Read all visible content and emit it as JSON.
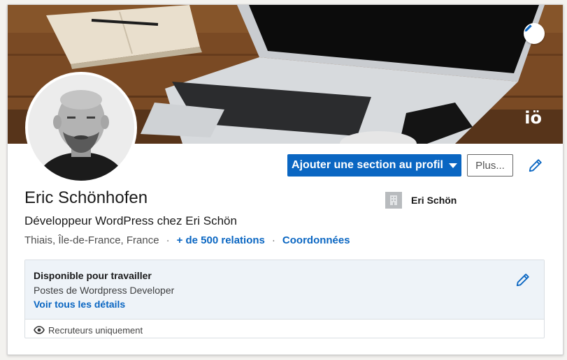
{
  "profile": {
    "name": "Eric Schönhofen",
    "headline": "Développeur WordPress chez Eri Schön",
    "location": "Thiais, Île-de-France, France",
    "separator": "·",
    "connections": "+ de 500 relations",
    "contact_info": "Coordonnées",
    "cover_watermark": "iö"
  },
  "company": {
    "name": "Eri Schön",
    "logo_icon": "building-icon"
  },
  "actions": {
    "add_section_label": "Ajouter une section au profil",
    "more_label": "Plus...",
    "edit_icon": "pencil-icon"
  },
  "open_to_work": {
    "title": "Disponible pour travailler",
    "subtitle": "Postes de Wordpress Developer",
    "details_link": "Voir tous les détails",
    "visibility": "Recruteurs uniquement",
    "visibility_icon": "eye-icon"
  },
  "colors": {
    "primary": "#0a66c2",
    "otw_background": "#eef3f8",
    "page_background": "#f3f2ef"
  }
}
